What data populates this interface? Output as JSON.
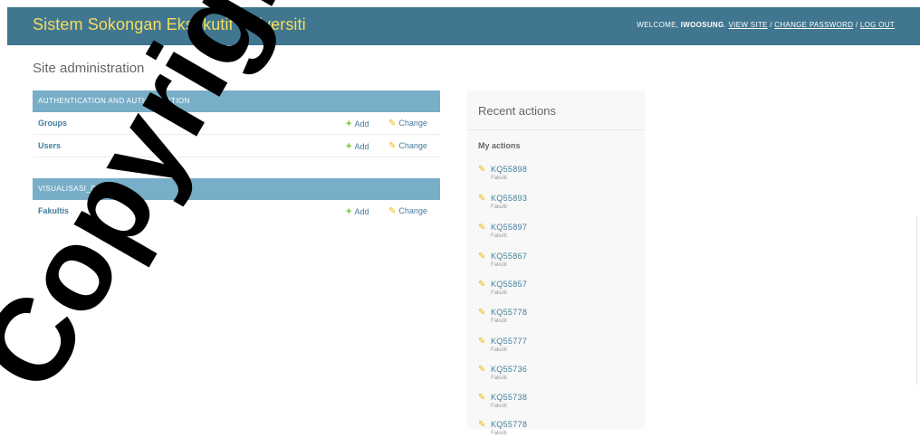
{
  "header": {
    "site_name": "Sistem Sokongan Eksekutif Universiti",
    "welcome_text": "WELCOME,",
    "username": "IWOOSUNG",
    "view_site": "VIEW SITE",
    "change_password": "CHANGE PASSWORD",
    "log_out": "LOG OUT",
    "separator": " / "
  },
  "page_title": "Site administration",
  "modules": [
    {
      "caption": "Authentication and Authorization",
      "models": [
        {
          "name": "Groups",
          "add_label": "Add",
          "change_label": "Change"
        },
        {
          "name": "Users",
          "add_label": "Add",
          "change_label": "Change"
        }
      ]
    },
    {
      "caption": "Visualisasi_Data",
      "models": [
        {
          "name": "Fakultis",
          "add_label": "Add",
          "change_label": "Change"
        }
      ]
    }
  ],
  "recent_actions": {
    "title": "Recent actions",
    "subtitle": "My actions",
    "items": [
      {
        "object": "KQ55898",
        "content_type": "Fakulti"
      },
      {
        "object": "KQ55893",
        "content_type": "Fakulti"
      },
      {
        "object": "KQ55897",
        "content_type": "Fakulti"
      },
      {
        "object": "KQ55867",
        "content_type": "Fakulti"
      },
      {
        "object": "KQ55857",
        "content_type": "Fakulti"
      },
      {
        "object": "KQ55778",
        "content_type": "Fakulti"
      },
      {
        "object": "KQ55777",
        "content_type": "Fakulti"
      },
      {
        "object": "KQ55736",
        "content_type": "Fakulti"
      },
      {
        "object": "KQ55738",
        "content_type": "Fakulti"
      },
      {
        "object": "KQ55778",
        "content_type": "Fakulti"
      }
    ]
  },
  "watermark": "Copyright",
  "icons": {
    "add": "plus-icon",
    "change": "pencil-icon"
  },
  "colors": {
    "header_bg": "#417690",
    "branding": "#f5dd5d",
    "caption_bg": "#79aec8",
    "link": "#447e9b",
    "add_icon": "#70bf2b",
    "change_icon": "#efb80b"
  }
}
